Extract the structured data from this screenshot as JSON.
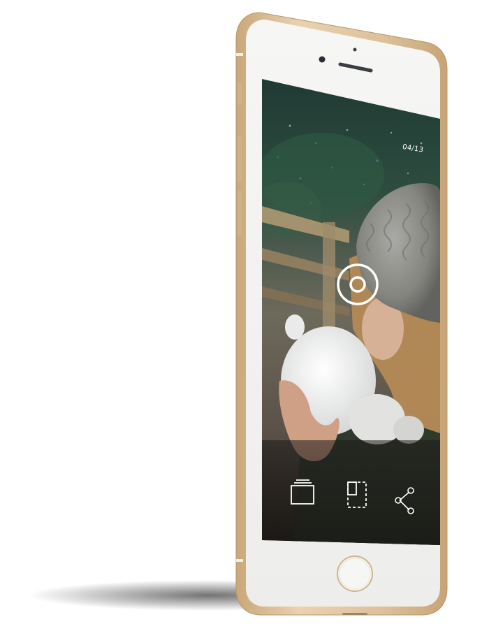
{
  "photo_viewer": {
    "counter": "04/13",
    "actions": {
      "gallery": "gallery-icon",
      "crop": "crop-icon",
      "share": "share-icon"
    },
    "capture": "capture-icon"
  },
  "device": {
    "finish_color": "#d8c09c",
    "face_color": "#f3f3f1"
  }
}
